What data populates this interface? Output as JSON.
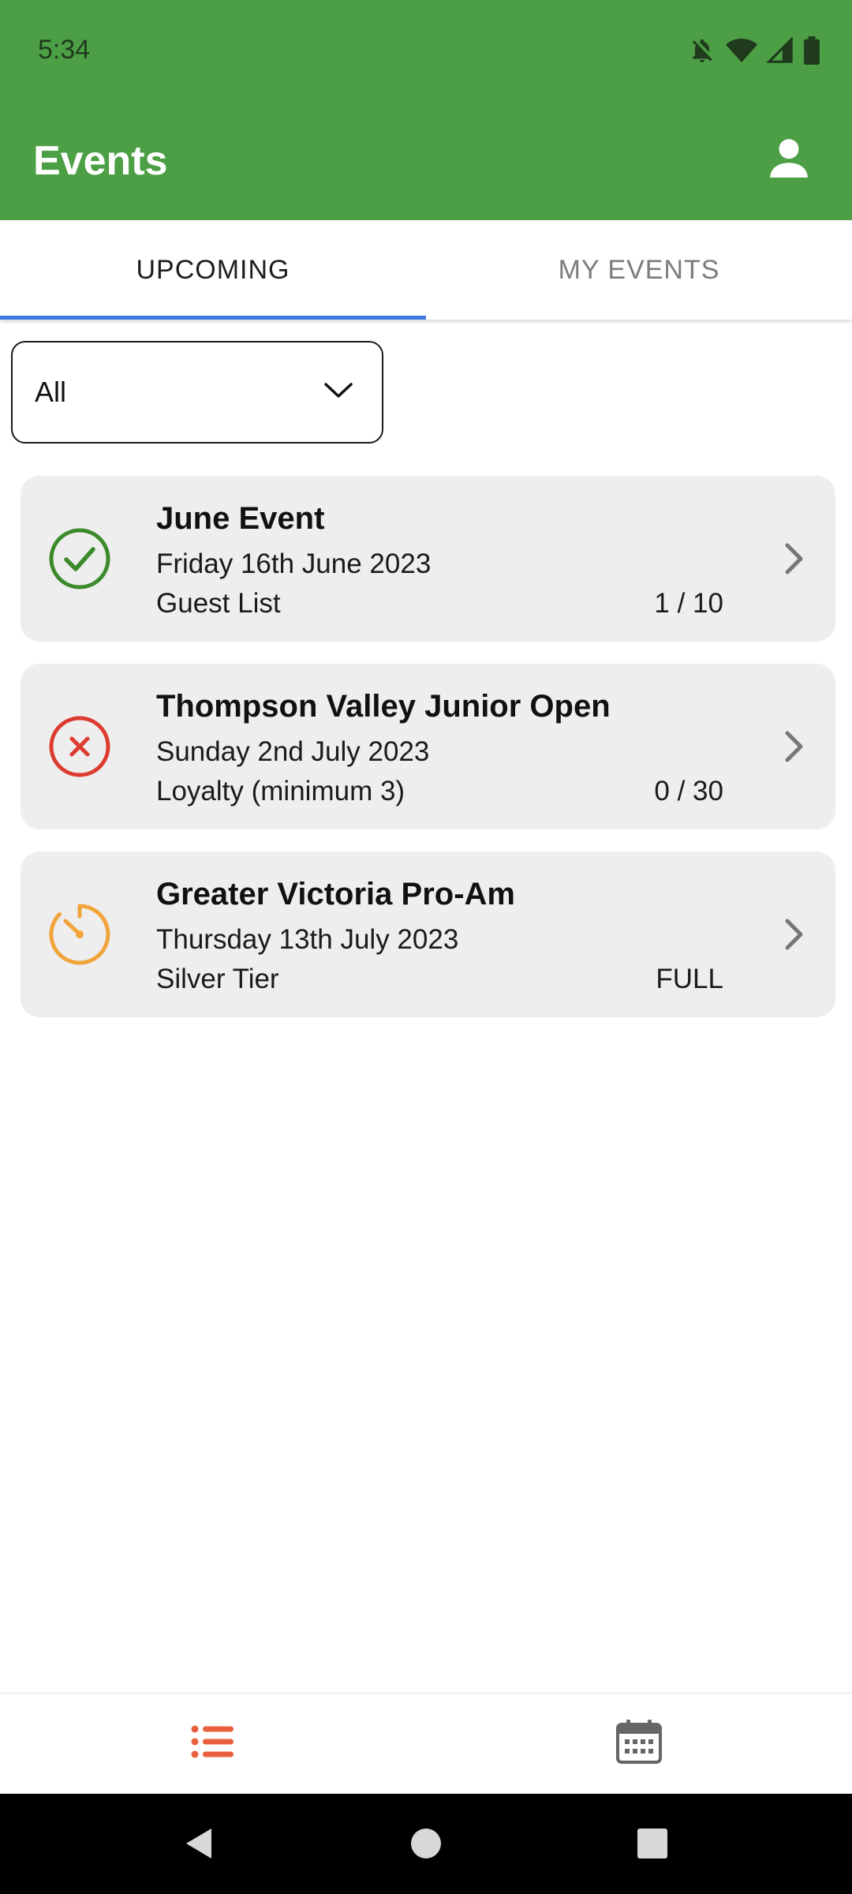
{
  "status_bar": {
    "time": "5:34",
    "icons": [
      "bell-off-icon",
      "wifi-icon",
      "signal-icon",
      "battery-icon"
    ]
  },
  "app_bar": {
    "title": "Events",
    "profile_icon": "person-icon"
  },
  "tabs": [
    {
      "label": "UPCOMING",
      "active": true
    },
    {
      "label": "MY EVENTS",
      "active": false
    }
  ],
  "filter": {
    "value": "All"
  },
  "events": [
    {
      "title": "June Event",
      "date": "Friday 16th June 2023",
      "tier": "Guest List",
      "count": "1 / 10",
      "status_icon": "check-circle-icon",
      "status_color": "#3b8a2c"
    },
    {
      "title": "Thompson Valley Junior Open",
      "date": "Sunday 2nd July 2023",
      "tier": "Loyalty (minimum 3)",
      "count": "0 / 30",
      "status_icon": "x-circle-icon",
      "status_color": "#dd3b2f"
    },
    {
      "title": "Greater Victoria Pro-Am",
      "date": "Thursday 13th July 2023",
      "tier": "Silver Tier",
      "count": "FULL",
      "status_icon": "timer-icon",
      "status_color": "#f1a43a"
    }
  ],
  "bottom_nav": [
    {
      "icon": "list-icon",
      "active": true,
      "color": "#e8603c"
    },
    {
      "icon": "calendar-icon",
      "active": false,
      "color": "#666666"
    }
  ],
  "colors": {
    "app_bar": "#4c9f44",
    "tab_indicator": "#3f7be0",
    "card_background": "#eeeeee"
  }
}
